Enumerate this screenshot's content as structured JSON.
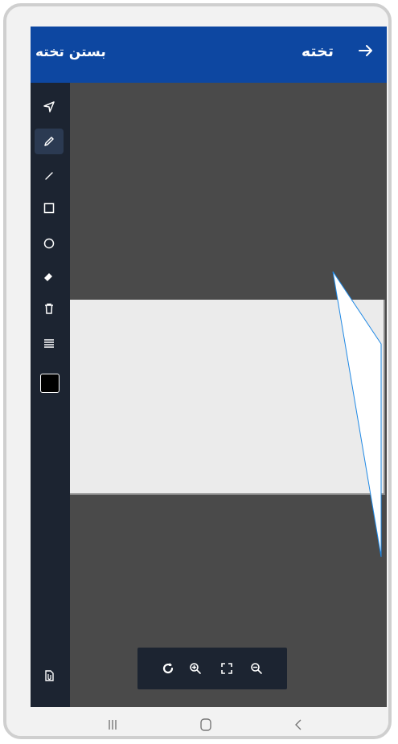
{
  "topbar": {
    "title": "تخته",
    "close_label": "بستن تخته",
    "back_icon": "arrow-right-icon",
    "background": "#0d47a1"
  },
  "sidebar": {
    "tools": [
      {
        "name": "select-tool",
        "icon": "navigation-arrow-icon",
        "active": false
      },
      {
        "name": "pen-tool",
        "icon": "pencil-icon",
        "active": true
      },
      {
        "name": "line-tool",
        "icon": "line-icon",
        "active": false
      },
      {
        "name": "rectangle-tool",
        "icon": "square-icon",
        "active": false
      },
      {
        "name": "circle-tool",
        "icon": "circle-icon",
        "active": false
      },
      {
        "name": "eraser-tool",
        "icon": "eraser-icon",
        "active": false
      },
      {
        "name": "delete-tool",
        "icon": "trash-icon",
        "active": false
      },
      {
        "name": "line-width-tool",
        "icon": "lines-icon",
        "active": false
      }
    ],
    "color": "#000000",
    "attach_icon": "attachment-file-icon"
  },
  "canvas": {
    "background": "#4a4a4a",
    "sheet_color": "#ebebeb"
  },
  "zoom_controls": [
    "refresh-icon",
    "zoom-in-icon",
    "fullscreen-icon",
    "zoom-out-icon"
  ],
  "system_nav": [
    "recent-apps-icon",
    "home-icon",
    "back-icon"
  ]
}
